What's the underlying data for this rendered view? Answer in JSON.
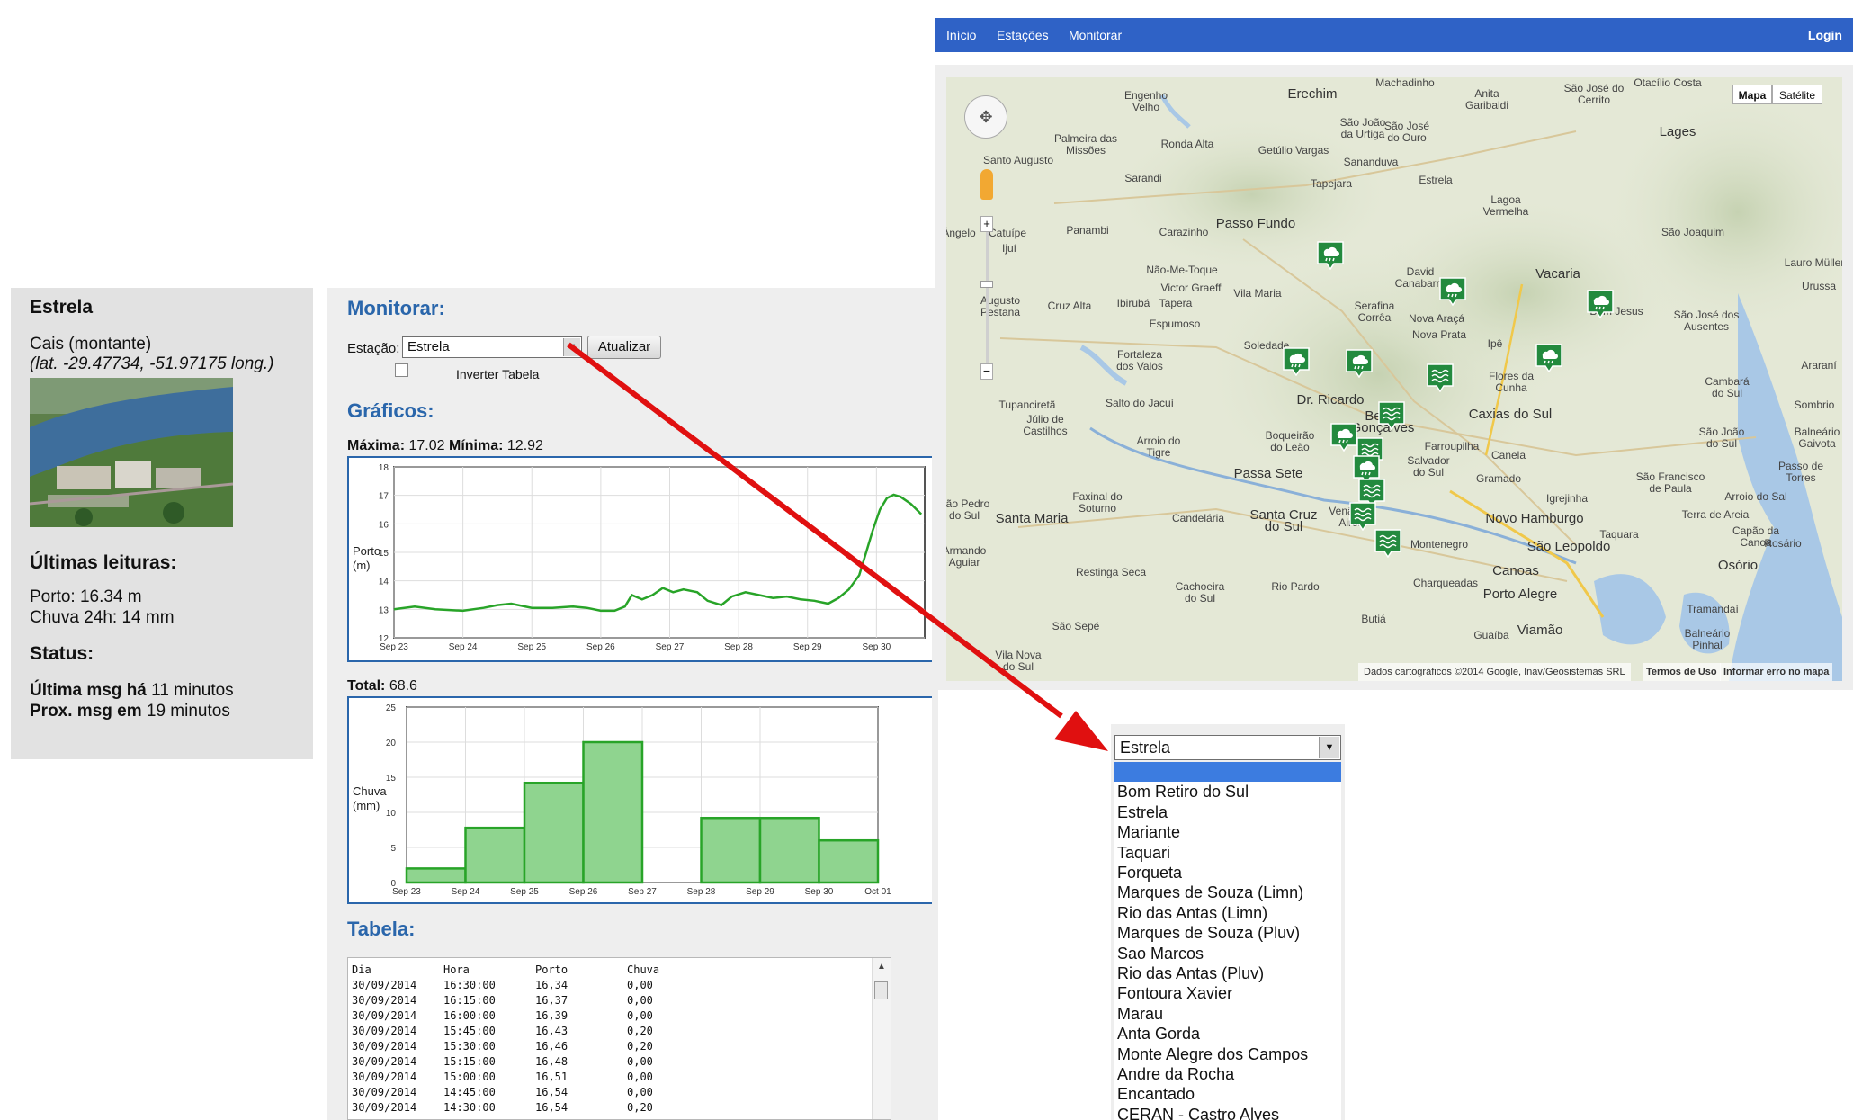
{
  "nav": {
    "items": [
      "Início",
      "Estações",
      "Monitorar"
    ],
    "login": "Login"
  },
  "station": {
    "name": "Estrela",
    "location": "Cais (montante)",
    "coords": "(lat. -29.47734, -51.97175 long.)",
    "readings_title": "Últimas leituras:",
    "porto_label": "Porto:",
    "porto_value": "16.34 m",
    "chuva_label": "Chuva 24h:",
    "chuva_value": "14 mm",
    "status_title": "Status:",
    "last_msg_label": "Última msg há",
    "last_msg_value": "11 minutos",
    "next_msg_label": "Prox. msg em",
    "next_msg_value": "19 minutos"
  },
  "monitor": {
    "title": "Monitorar:",
    "station_label": "Estação:",
    "station_selected": "Estrela",
    "update_button": "Atualizar",
    "invert_label": "Inverter Tabela",
    "invert_checked": false,
    "graphs_title": "Gráficos:",
    "max_label": "Máxima:",
    "max_value": "17.02",
    "min_label": "Mínima:",
    "min_value": "12.92",
    "total_label": "Total:",
    "total_value": "68.6",
    "table_title": "Tabela:"
  },
  "chart_data": [
    {
      "type": "line",
      "ylabel": "Porto (m)",
      "ylim": [
        12,
        18
      ],
      "yticks": [
        "12",
        "13",
        "14",
        "15",
        "16",
        "17",
        "18"
      ],
      "xlim": [
        0,
        7.7
      ],
      "xticks": [
        "Sep 23",
        "Sep 24",
        "Sep 25",
        "Sep 26",
        "Sep 27",
        "Sep 28",
        "Sep 29",
        "Sep 30"
      ],
      "color": "#28a428",
      "grid": true,
      "x": [
        0,
        0.3,
        0.6,
        1.0,
        1.3,
        1.5,
        1.7,
        2.0,
        2.3,
        2.6,
        2.8,
        3.0,
        3.2,
        3.35,
        3.45,
        3.6,
        3.75,
        3.9,
        4.05,
        4.2,
        4.4,
        4.55,
        4.75,
        4.9,
        5.1,
        5.3,
        5.5,
        5.7,
        5.9,
        6.1,
        6.3,
        6.45,
        6.6,
        6.75,
        6.85,
        6.95,
        7.05,
        7.15,
        7.25,
        7.35,
        7.5,
        7.65
      ],
      "y": [
        13.0,
        13.1,
        13.0,
        12.95,
        13.05,
        13.15,
        13.2,
        13.05,
        13.05,
        13.1,
        13.05,
        12.95,
        12.95,
        13.1,
        13.5,
        13.35,
        13.5,
        13.75,
        13.6,
        13.7,
        13.6,
        13.3,
        13.15,
        13.45,
        13.6,
        13.5,
        13.4,
        13.45,
        13.35,
        13.3,
        13.2,
        13.4,
        13.7,
        14.2,
        15.0,
        15.8,
        16.5,
        16.9,
        17.02,
        16.95,
        16.7,
        16.34
      ]
    },
    {
      "type": "bar",
      "ylabel": "Chuva (mm)",
      "ylim": [
        0,
        25
      ],
      "yticks": [
        "0",
        "5",
        "10",
        "15",
        "20",
        "25"
      ],
      "xticks": [
        "Sep 23",
        "Sep 24",
        "Sep 25",
        "Sep 26",
        "Sep 27",
        "Sep 28",
        "Sep 29",
        "Sep 30",
        "Oct 01"
      ],
      "color": "#28a428",
      "fill": "#8fd48f",
      "grid": true,
      "values": [
        2.0,
        7.8,
        14.2,
        20.0,
        0.0,
        9.2,
        9.2,
        6.0
      ]
    }
  ],
  "table": {
    "headers": [
      "Dia",
      "Hora",
      "Porto",
      "Chuva"
    ],
    "rows": [
      [
        "30/09/2014",
        "16:30:00",
        "16,34",
        "0,00"
      ],
      [
        "30/09/2014",
        "16:15:00",
        "16,37",
        "0,00"
      ],
      [
        "30/09/2014",
        "16:00:00",
        "16,39",
        "0,00"
      ],
      [
        "30/09/2014",
        "15:45:00",
        "16,43",
        "0,20"
      ],
      [
        "30/09/2014",
        "15:30:00",
        "16,46",
        "0,20"
      ],
      [
        "30/09/2014",
        "15:15:00",
        "16,48",
        "0,00"
      ],
      [
        "30/09/2014",
        "15:00:00",
        "16,51",
        "0,00"
      ],
      [
        "30/09/2014",
        "14:45:00",
        "16,54",
        "0,00"
      ],
      [
        "30/09/2014",
        "14:30:00",
        "16,54",
        "0,20"
      ]
    ]
  },
  "map": {
    "type_map": "Mapa",
    "type_satellite": "Satélite",
    "attribution": "Dados cartográficos ©2014 Google, Inav/Geosistemas SRL",
    "terms": "Termos de Uso",
    "report": "Informar erro no mapa",
    "towns": [
      "Erechim",
      "Engenho Velho",
      "Palmeira das Missões",
      "Ronda Alta",
      "Getúlio Vargas",
      "São João da Urtiga",
      "São José do Ouro",
      "Machadinho",
      "Anita Garibaldi",
      "São José do Cerrito",
      "Otacílio Costa",
      "Lages",
      "Santo Augusto",
      "Sarandi",
      "Tapejara",
      "Sananduva",
      "Estrela",
      "Lagoa Vermelha",
      "Panambi",
      "Carazinho",
      "Passo Fundo",
      "Catuípe",
      "Ijuí",
      "Ângelo",
      "Não-Me-Toque",
      "David Canabarro",
      "Vacaria",
      "São Joaquim",
      "Lauro Müller",
      "Augusto Pestana",
      "Cruz Alta",
      "Ibirubá",
      "Tapera",
      "Victor Graeff",
      "Vila Maria",
      "Serafina Corrêa",
      "Nova Araçá",
      "Bom Jesus",
      "São José dos Ausentes",
      "Urussa",
      "Espumoso",
      "Soledade",
      "Nova Prata",
      "Ipê",
      "Fortaleza dos Valos",
      "Flores da Cunha",
      "Cambará do Sul",
      "Araraní",
      "Tupanciretã",
      "Júlio de Castilhos",
      "Salto do Jacuí",
      "Dr. Ricardo",
      "Bento Gonçalves",
      "Caxias do Sul",
      "Sombrio",
      "Arroio do Tigre",
      "Boqueirão do Leão",
      "Farroupilha",
      "Salvador do Sul",
      "Canela",
      "São João do Sul",
      "Balneário Gaivota",
      "Passa Sete",
      "Gramado",
      "São Francisco de Paula",
      "Passo de Torres",
      "São Pedro do Sul",
      "Faxinal do Soturno",
      "Santa Maria",
      "Candelária",
      "Santa Cruz do Sul",
      "Venâncio Aires",
      "Igrejinha",
      "Arroio do Sal",
      "Novo Hamburgo",
      "Taquara",
      "Terra de Areia",
      "Capão da Canoa",
      "Rosário",
      "Montenegro",
      "São Leopoldo",
      "Osório",
      "Restinga Seca",
      "Cachoeira do Sul",
      "Rio Pardo",
      "Charqueadas",
      "Canoas",
      "Porto Alegre",
      "Tramandaí",
      "Butiá",
      "Guaíba",
      "Viamão",
      "Balneário Pinhal",
      "São Sepé",
      "Vila Nova do Sul",
      "Armando Aguiar"
    ]
  },
  "dropdown": {
    "selected": "Estrela",
    "options": [
      "",
      "Bom Retiro do Sul",
      "Estrela",
      "Mariante",
      "Taquari",
      "Forqueta",
      "Marques de Souza (Limn)",
      "Rio das Antas (Limn)",
      "Marques de Souza (Pluv)",
      "Sao Marcos",
      "Rio das Antas (Pluv)",
      "Fontoura Xavier",
      "Marau",
      "Anta Gorda",
      "Monte Alegre dos Campos",
      "Andre da Rocha",
      "Encantado",
      "CERAN - Castro Alves"
    ]
  },
  "colors": {
    "nav": "#2f62c6",
    "section_title": "#2a66ab",
    "marker": "#238a3e",
    "arrow": "#e01010",
    "dropdown_highlight": "#3c7ce0"
  }
}
